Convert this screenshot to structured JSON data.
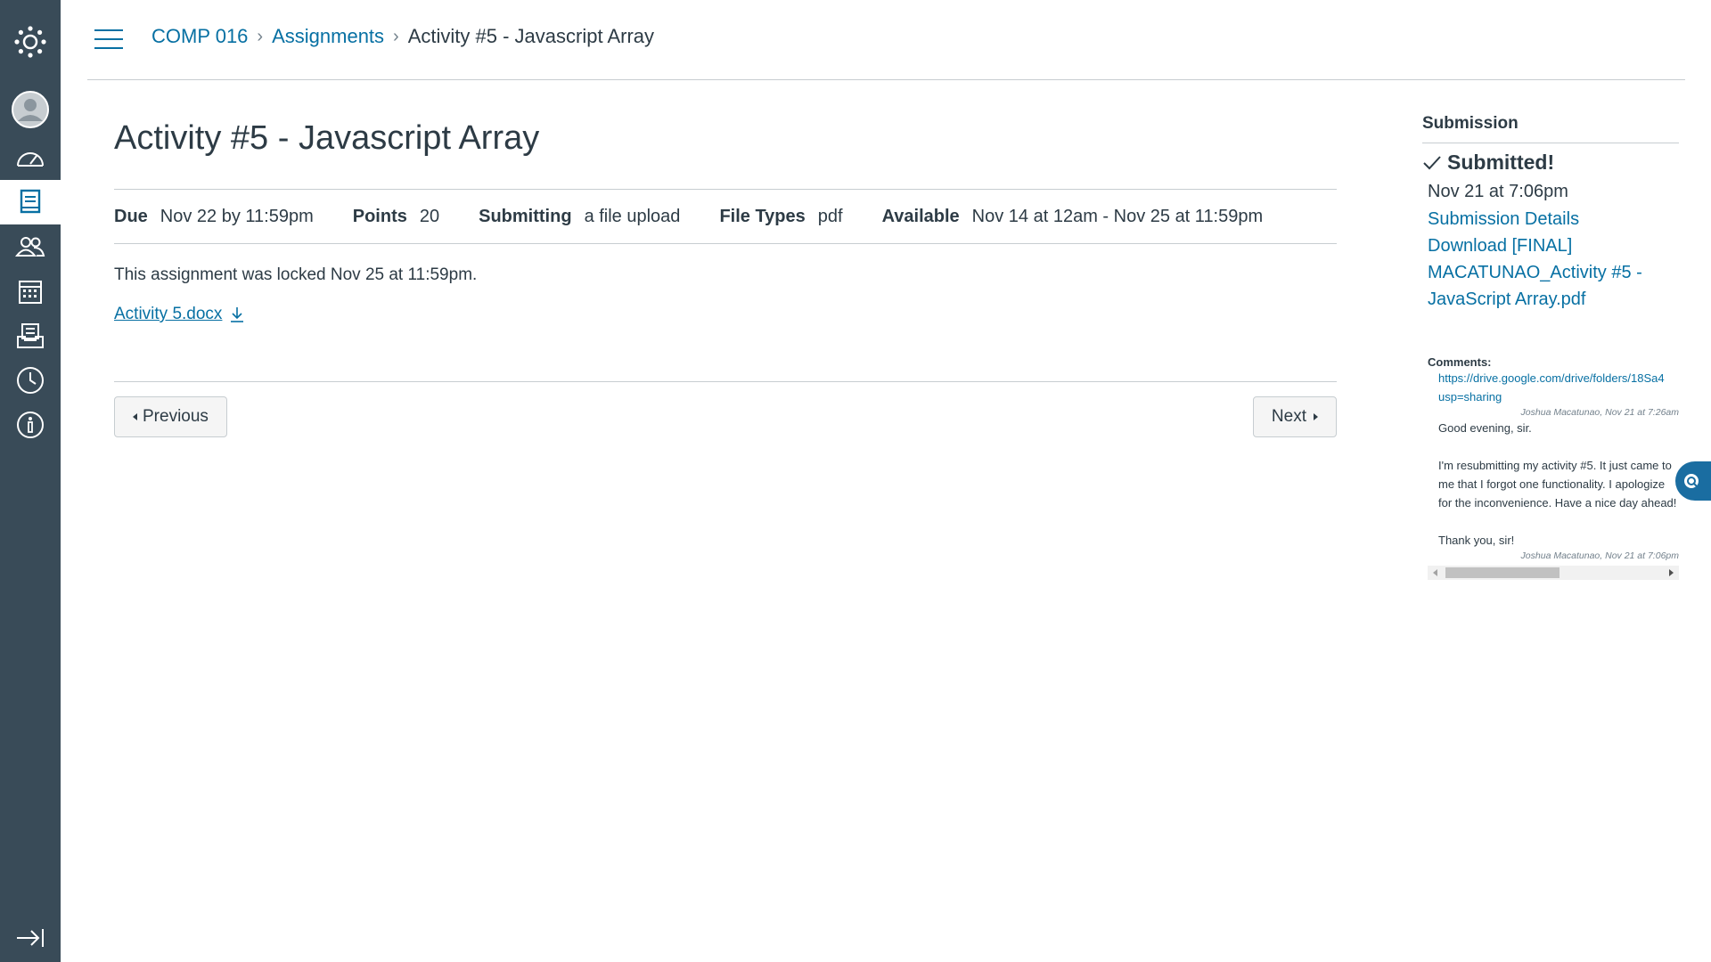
{
  "global_nav": {
    "items": [
      {
        "name": "logo",
        "icon": "canvas-logo-icon"
      },
      {
        "name": "account",
        "icon": "user-avatar-icon"
      },
      {
        "name": "dashboard",
        "icon": "dashboard-icon"
      },
      {
        "name": "courses",
        "icon": "courses-icon",
        "active": true
      },
      {
        "name": "groups",
        "icon": "groups-icon"
      },
      {
        "name": "calendar",
        "icon": "calendar-icon"
      },
      {
        "name": "inbox",
        "icon": "inbox-icon"
      },
      {
        "name": "history",
        "icon": "clock-icon"
      },
      {
        "name": "help",
        "icon": "info-icon"
      }
    ],
    "collapse_icon": "collapse-nav-icon"
  },
  "breadcrumb": {
    "course": "COMP 016",
    "section": "Assignments",
    "current": "Activity #5 - Javascript Array"
  },
  "assignment": {
    "title": "Activity #5 - Javascript Array",
    "due_label": "Due",
    "due_value": "Nov 22 by 11:59pm",
    "points_label": "Points",
    "points_value": "20",
    "submitting_label": "Submitting",
    "submitting_value": "a file upload",
    "file_types_label": "File Types",
    "file_types_value": "pdf",
    "available_label": "Available",
    "available_value": "Nov 14 at 12am - Nov 25 at 11:59pm",
    "locked_text": "This assignment was locked Nov 25 at 11:59pm.",
    "attachment": "Activity 5.docx"
  },
  "pager": {
    "previous": "Previous",
    "next": "Next"
  },
  "submission": {
    "heading": "Submission",
    "status": "Submitted!",
    "date": "Nov 21 at 7:06pm",
    "details_link": "Submission Details",
    "download_link": "Download [FINAL] MACATUNAO_Activity #5 - JavaScript Array.pdf",
    "comments_label": "Comments:",
    "comments": [
      {
        "link_line1": "https://drive.google.com/drive/folders/18Sa4",
        "link_line2": "usp=sharing",
        "meta": "Joshua Macatunao, Nov 21 at 7:26am"
      },
      {
        "line1": "Good evening, sir.",
        "line2": "I'm resubmitting my activity #5. It just came to me that I forgot one functionality. I apologize for the inconvenience. Have a nice day ahead!",
        "line3": "Thank you, sir!",
        "meta": "Joshua Macatunao, Nov 21 at 7:06pm"
      }
    ]
  },
  "colors": {
    "nav_bg": "#394b58",
    "link": "#0770a3",
    "text": "#2d3b45"
  }
}
